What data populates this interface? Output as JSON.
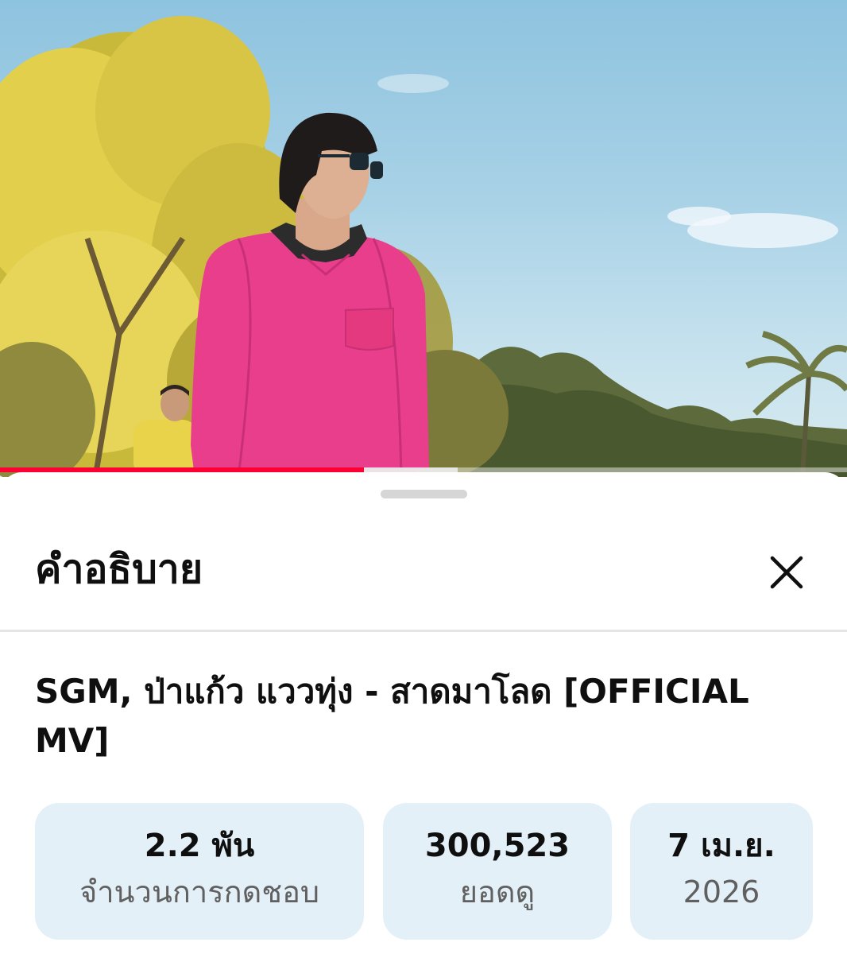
{
  "video": {
    "progress_played_fraction": 0.43,
    "progress_buffered_fraction": 0.54,
    "accent_color": "#ff0033"
  },
  "sheet": {
    "title": "คำอธิบาย",
    "close_icon": "close-icon",
    "video_title": "SGM, ป่าแก้ว แววทุ่ง - สาดมาโลด [OFFICIAL MV]",
    "stats": [
      {
        "value": "2.2 พัน",
        "label": "จำนวนการกดชอบ"
      },
      {
        "value": "300,523",
        "label": "ยอดดู"
      },
      {
        "value": "7 เม.ย.",
        "label": "2026"
      }
    ],
    "stat_background": "#e3f0f8"
  }
}
